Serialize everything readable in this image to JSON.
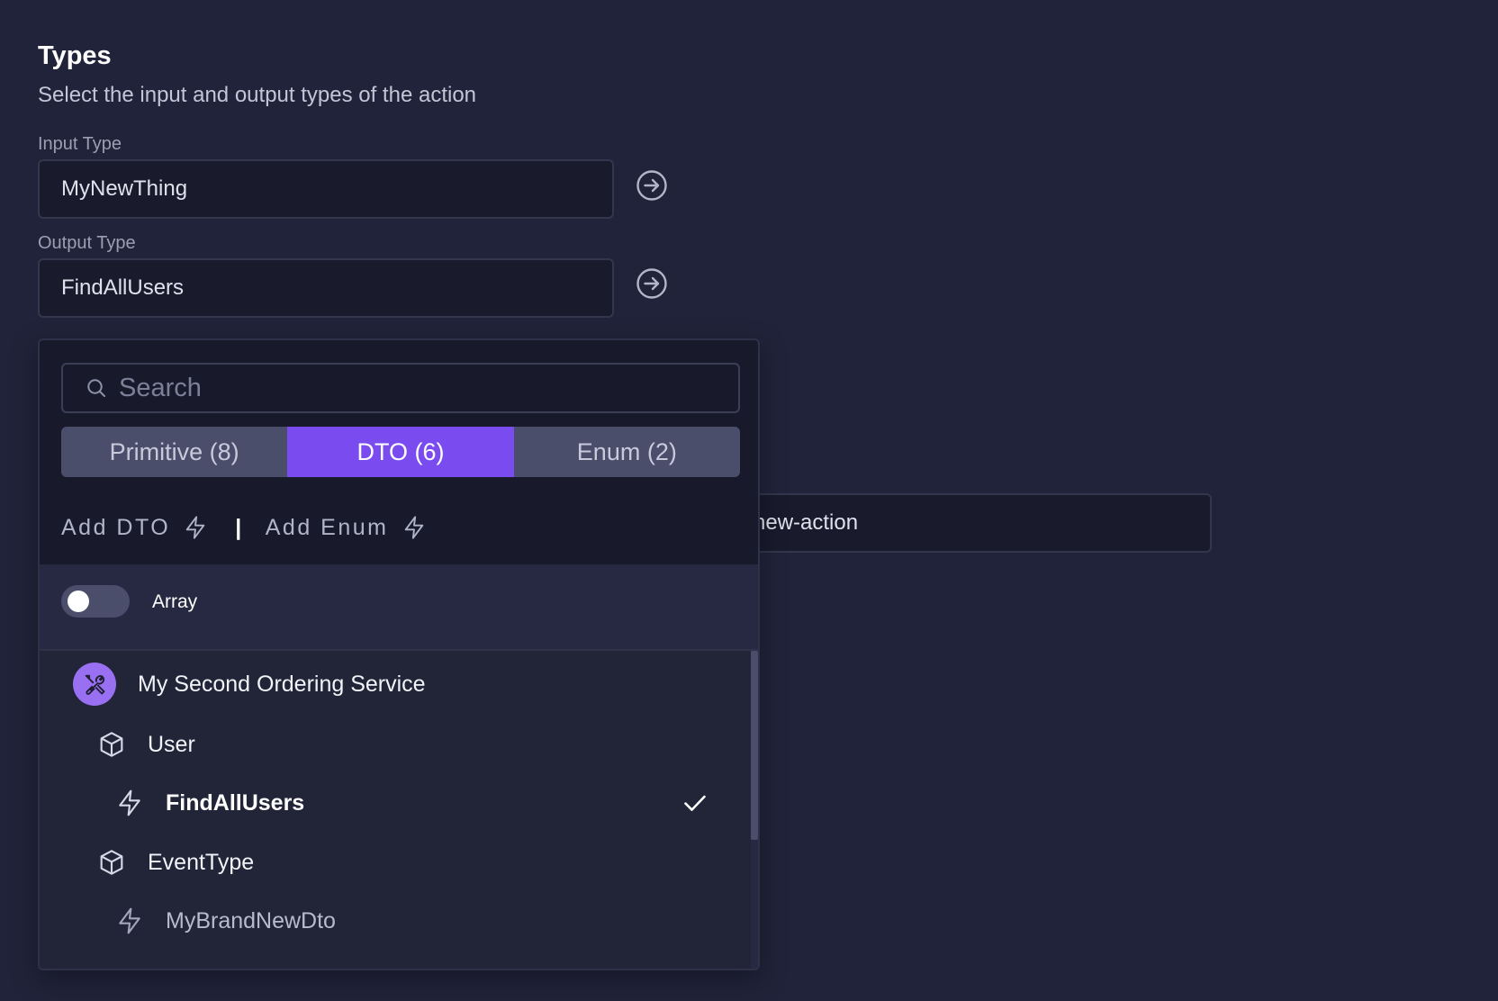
{
  "section": {
    "title": "Types",
    "description": "Select the input and output types of the action"
  },
  "input_type": {
    "label": "Input Type",
    "value": "MyNewThing"
  },
  "output_type": {
    "label": "Output Type",
    "value": "FindAllUsers"
  },
  "background_field": {
    "value": "new-action"
  },
  "dropdown": {
    "search_placeholder": "Search",
    "tabs": [
      {
        "label": "Primitive (8)",
        "active": false
      },
      {
        "label": "DTO (6)",
        "active": true
      },
      {
        "label": "Enum (2)",
        "active": false
      }
    ],
    "add_dto_label": "Add DTO",
    "separator": "|",
    "add_enum_label": "Add Enum",
    "array_label": "Array",
    "array_enabled": false,
    "tree": {
      "service": {
        "label": "My Second Ordering Service",
        "icon": "tools-icon"
      },
      "items": [
        {
          "label": "User",
          "icon": "cube-icon"
        },
        {
          "label": "FindAllUsers",
          "icon": "lightning-icon",
          "selected": true
        },
        {
          "label": "EventType",
          "icon": "cube-icon"
        },
        {
          "label": "MyBrandNewDto",
          "icon": "lightning-icon",
          "selected": false
        }
      ]
    }
  },
  "colors": {
    "background": "#21233a",
    "accent": "#7a4cf0",
    "service_avatar": "#9a70f2"
  }
}
